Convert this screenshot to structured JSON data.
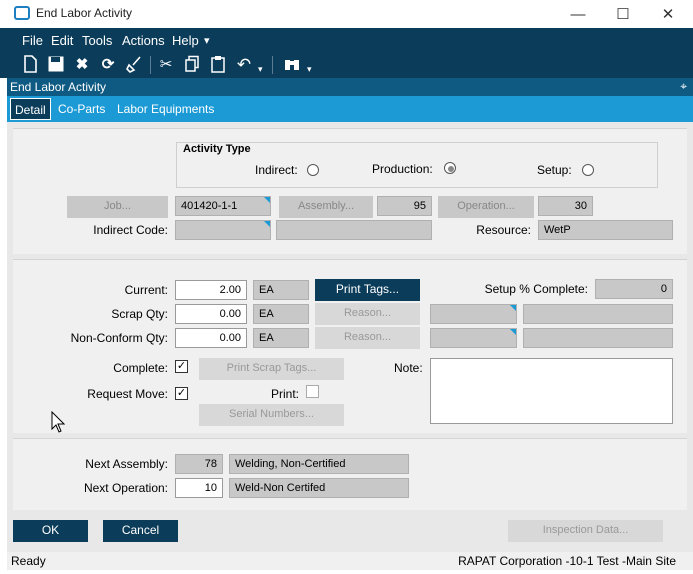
{
  "window": {
    "title": "End Labor Activity",
    "minimize": "—",
    "maximize": "☐",
    "close": "✕"
  },
  "menu": {
    "items": [
      "File",
      "Edit",
      "Tools",
      "Actions",
      "Help"
    ],
    "help_suffix": "▾"
  },
  "toolbar": {
    "icons": [
      "new-icon",
      "save-icon",
      "delete-icon",
      "refresh-icon",
      "clear-icon",
      "cut-icon",
      "copy-icon",
      "paste-icon",
      "undo-icon",
      "binoculars-icon"
    ]
  },
  "panel": {
    "title": "End Labor Activity",
    "pin": "⌖"
  },
  "tabs": [
    {
      "label": "Detail",
      "active": true
    },
    {
      "label": "Co-Parts"
    },
    {
      "label": "Labor Equipments"
    }
  ],
  "activity_type": {
    "legend": "Activity Type",
    "indirect_label": "Indirect:",
    "production_label": "Production:",
    "setup_label": "Setup:",
    "selected": "Production"
  },
  "job": {
    "button": "Job...",
    "value": "401420-1-1"
  },
  "assembly": {
    "button": "Assembly...",
    "value": "95"
  },
  "operation": {
    "button": "Operation...",
    "value": "30"
  },
  "indirect_code": {
    "label": "Indirect Code:",
    "value": "",
    "desc": ""
  },
  "resource": {
    "label": "Resource:",
    "value": "WetP"
  },
  "current": {
    "label": "Current:",
    "value": "2.00",
    "uom": "EA"
  },
  "print_tags": {
    "label": "Print Tags..."
  },
  "setup_complete": {
    "label": "Setup % Complete:",
    "value": "0"
  },
  "scrap_qty": {
    "label": "Scrap Qty:",
    "value": "0.00",
    "uom": "EA",
    "reason": "Reason..."
  },
  "nonconform_qty": {
    "label": "Non-Conform Qty:",
    "value": "0.00",
    "uom": "EA",
    "reason": "Reason..."
  },
  "complete": {
    "label": "Complete:",
    "checked": true
  },
  "print_scrap_tags": {
    "label": "Print Scrap Tags..."
  },
  "note": {
    "label": "Note:",
    "value": ""
  },
  "request_move": {
    "label": "Request Move:",
    "checked": true
  },
  "print": {
    "label": "Print:",
    "checked": false
  },
  "serial_numbers": {
    "label": "Serial Numbers..."
  },
  "next_assembly": {
    "label": "Next Assembly:",
    "value": "78",
    "desc": "Welding, Non-Certified"
  },
  "next_operation": {
    "label": "Next Operation:",
    "value": "10",
    "desc": "Weld-Non Certifed"
  },
  "buttons": {
    "ok": "OK",
    "cancel": "Cancel",
    "inspection": "Inspection Data..."
  },
  "status": {
    "left": "Ready",
    "right": "RAPAT Corporation -10-1 Test -Main Site"
  },
  "check_glyph": "✓",
  "colors": {
    "nav": "#0b3c5a",
    "tabs": "#1b9ad6",
    "panel_header": "#0e5a82"
  }
}
